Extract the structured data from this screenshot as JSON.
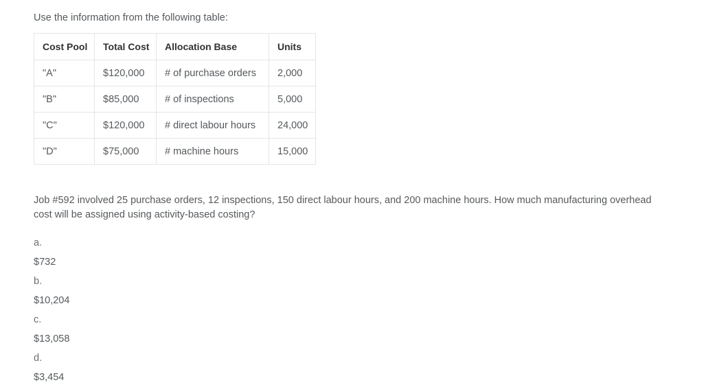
{
  "intro": "Use the information from the following table:",
  "table": {
    "headers": [
      "Cost Pool",
      "Total Cost",
      "Allocation Base",
      "Units"
    ],
    "rows": [
      {
        "pool": "\"A\"",
        "total_cost": "$120,000",
        "allocation_base": "# of purchase orders",
        "units": "2,000"
      },
      {
        "pool": "\"B\"",
        "total_cost": "$85,000",
        "allocation_base": "# of inspections",
        "units": "5,000"
      },
      {
        "pool": "\"C\"",
        "total_cost": "$120,000",
        "allocation_base": "# direct labour hours",
        "units": "24,000"
      },
      {
        "pool": "\"D\"",
        "total_cost": "$75,000",
        "allocation_base": "# machine hours",
        "units": "15,000"
      }
    ]
  },
  "question": "Job #592 involved 25 purchase orders, 12 inspections, 150 direct labour hours, and 200 machine hours. How much manufacturing overhead cost will be assigned using activity-based costing?",
  "options": [
    {
      "letter": "a.",
      "value": "$732"
    },
    {
      "letter": "b.",
      "value": "$10,204"
    },
    {
      "letter": "c.",
      "value": "$13,058"
    },
    {
      "letter": "d.",
      "value": "$3,454"
    }
  ],
  "colors": {
    "text": "#55595c",
    "heading_text": "#2f3133",
    "table_border": "#e3e5e6",
    "background": "#ffffff"
  }
}
